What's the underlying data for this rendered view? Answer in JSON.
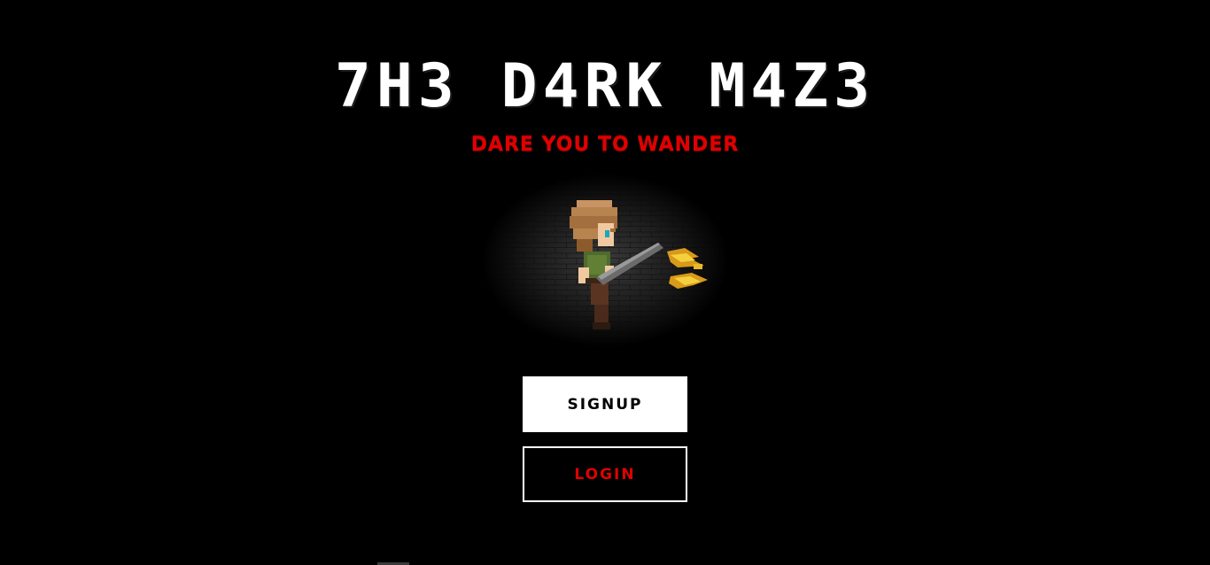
{
  "title": "7H3 D4RK M4Z3",
  "subtitle": "DARE YOU TO WANDER",
  "buttons": {
    "signup_label": "SIGNUP",
    "login_label": "LOGIN"
  },
  "colors": {
    "background": "#000000",
    "title": "#ffffff",
    "accent_red": "#e00000",
    "signup_bg": "#ffffff"
  },
  "hero": {
    "icon": "pixel-adventurer-with-flaming-weapon"
  }
}
